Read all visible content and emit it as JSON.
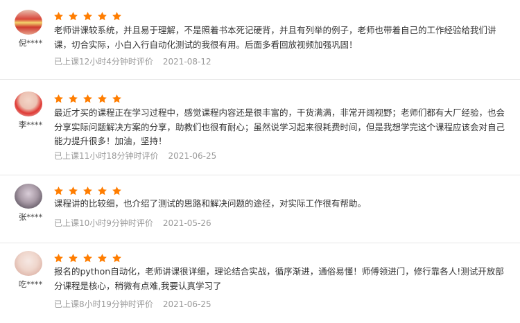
{
  "colors": {
    "star": "#ff7d00",
    "meta_text": "#9a9a9a",
    "divider": "#e6e6e6"
  },
  "reviews": [
    {
      "user": "倪****",
      "rating": 5,
      "comment": "老师讲课较系统，并且易于理解，不是照着书本死记硬背，并且有列举的例子，老师也带着自己的工作经验给我们讲课，切合实际，小白入行自动化测试的我很有用。后面多看回放视频加强巩固！",
      "study_time": "已上课12小时4分钟时评价",
      "date": "2021-08-12"
    },
    {
      "user": "李****",
      "rating": 5,
      "comment": "最近才买的课程正在学习过程中，感觉课程内容还是很丰富的，干货满满，非常开阔视野；老师们都有大厂经验，也会分享实际问题解决方案的分享，助教们也很有耐心；虽然说学习起来很耗费时间，但是我想学完这个课程应该会对自己能力提升很多！加油，坚持！",
      "study_time": "已上课11小时18分钟时评价",
      "date": "2021-06-25"
    },
    {
      "user": "张****",
      "rating": 5,
      "comment": "课程讲的比较细，也介绍了测试的思路和解决问题的途径，对实际工作很有帮助。",
      "study_time": "已上课10小时9分钟时评价",
      "date": "2021-05-26"
    },
    {
      "user": "吃****",
      "rating": 5,
      "comment": "报名的python自动化，老师讲课很详细，理论结合实战，循序渐进，通俗易懂！师傅领进门，修行靠各人!测试开放部分课程是核心，稍微有点难,我要认真学习了",
      "study_time": "已上课8小时19分钟时评价",
      "date": "2021-06-25"
    }
  ]
}
